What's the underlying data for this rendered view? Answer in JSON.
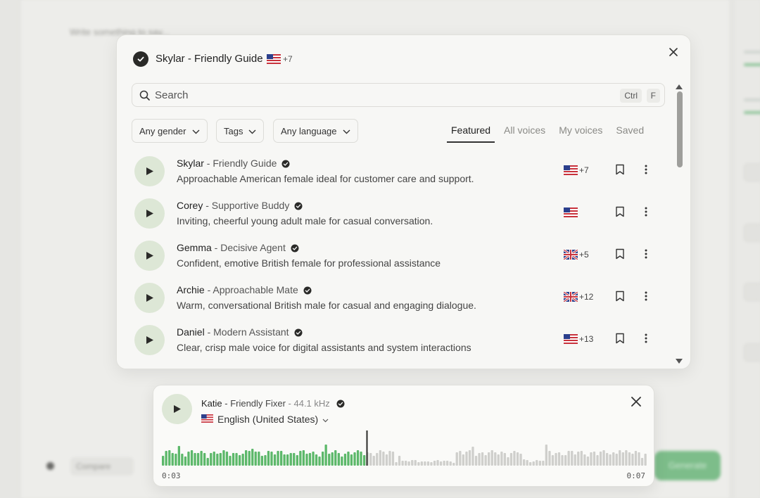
{
  "background": {
    "title": "Write something to say...",
    "compare_label": "Compare",
    "generate_label": "Generate"
  },
  "selected_voice": {
    "name": "Skylar",
    "role": "Friendly Guide",
    "title": "Skylar - Friendly Guide",
    "flag": "us",
    "extra_languages": "+7"
  },
  "search": {
    "placeholder": "Search",
    "shortcut_keys": [
      "Ctrl",
      "F"
    ]
  },
  "filters": {
    "gender": "Any gender",
    "tags": "Tags",
    "language": "Any language"
  },
  "tabs": [
    {
      "label": "Featured",
      "active": true
    },
    {
      "label": "All voices",
      "active": false
    },
    {
      "label": "My voices",
      "active": false
    },
    {
      "label": "Saved",
      "active": false
    }
  ],
  "voices": [
    {
      "name": "Skylar",
      "role": " - Friendly Guide",
      "description": "Approachable American female ideal for customer care and support.",
      "flag": "us",
      "extra": "+7"
    },
    {
      "name": "Corey",
      "role": " - Supportive Buddy",
      "description": "Inviting, cheerful young adult male for casual conversation.",
      "flag": "us",
      "extra": ""
    },
    {
      "name": "Gemma",
      "role": " - Decisive Agent",
      "description": "Confident, emotive British female for professional assistance",
      "flag": "uk",
      "extra": "+5"
    },
    {
      "name": "Archie",
      "role": " - Approachable Mate",
      "description": "Warm, conversational British male for casual and engaging dialogue.",
      "flag": "uk",
      "extra": "+12"
    },
    {
      "name": "Daniel",
      "role": " - Modern Assistant",
      "description": "Clear, crisp male voice for digital assistants and system interactions",
      "flag": "us",
      "extra": "+13"
    }
  ],
  "player": {
    "name": "Katie",
    "role": " - Friendly Fixer",
    "sample_rate": " - 44.1 kHz",
    "language": "English (United States)",
    "current_time": "0:03",
    "total_time": "0:07",
    "progress": 0.42,
    "played_color": "#5cb86a",
    "unplayed_color": "#cfcfcc"
  },
  "colors": {
    "accent_green": "#5cb86a",
    "play_bg": "#dde7d6"
  }
}
